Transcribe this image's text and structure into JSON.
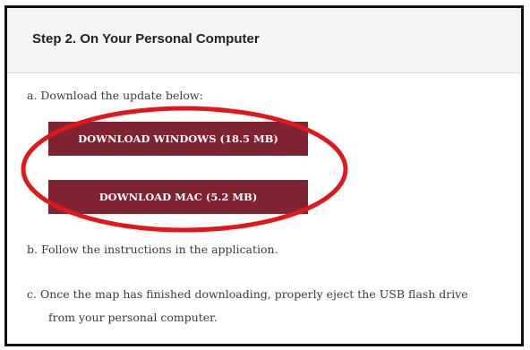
{
  "step": {
    "title": "Step 2. On Your Personal Computer"
  },
  "instructions": {
    "a": "a.  Download the update below:",
    "b": "b.  Follow the instructions in the application.",
    "c_line1": "c.  Once the map has finished downloading, properly eject the USB flash drive",
    "c_line2": "from your personal computer."
  },
  "downloads": {
    "windows_label": "DOWNLOAD WINDOWS (18.5 MB)",
    "mac_label": "DOWNLOAD MAC (5.2 MB)"
  },
  "colors": {
    "button_bg": "#7f2232",
    "highlight_circle": "#e0181d",
    "frame_border": "#111111",
    "header_bg": "#f4f4f4"
  }
}
